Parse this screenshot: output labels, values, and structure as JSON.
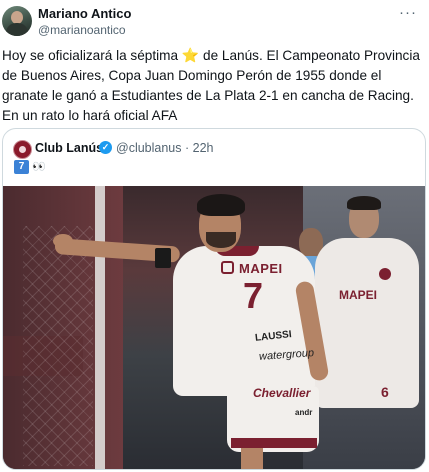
{
  "author": {
    "name": "Mariano Antico",
    "handle": "@marianoantico"
  },
  "tweet": {
    "text_before_star": "Hoy se oficializará la séptima ",
    "star": "⭐",
    "text_after_star": " de Lanús. El Campeonato Provincia de Buenos Aires, Copa Juan Domingo Perón de 1955 donde el granate le ganó a Estudiantes de La Plata 2-1 en cancha de Racing. En un rato lo hará oficial AFA"
  },
  "quote": {
    "club_name": "Club Lanús",
    "handle": "@clublanus",
    "separator": "·",
    "time": "22h",
    "badge": "7",
    "eyes": "👀",
    "photo": {
      "player_sponsor": "MAPEI",
      "player_number": "7",
      "player_name": "LAUSSI",
      "shirt_maker": "watergroup",
      "shorts_brand": "Chevallier",
      "shorts_sub": "andr",
      "bg_sponsor": "MAPEI",
      "bg_number": "6"
    }
  },
  "icons": {
    "more": "more-horizontal-icon",
    "verified": "verified-badge-icon",
    "star": "star-emoji-icon",
    "eyes": "eyes-emoji-icon"
  },
  "colors": {
    "granate": "#7b2030",
    "verified": "#1d9bf0",
    "muted": "#536471",
    "border": "#cfd9de"
  }
}
